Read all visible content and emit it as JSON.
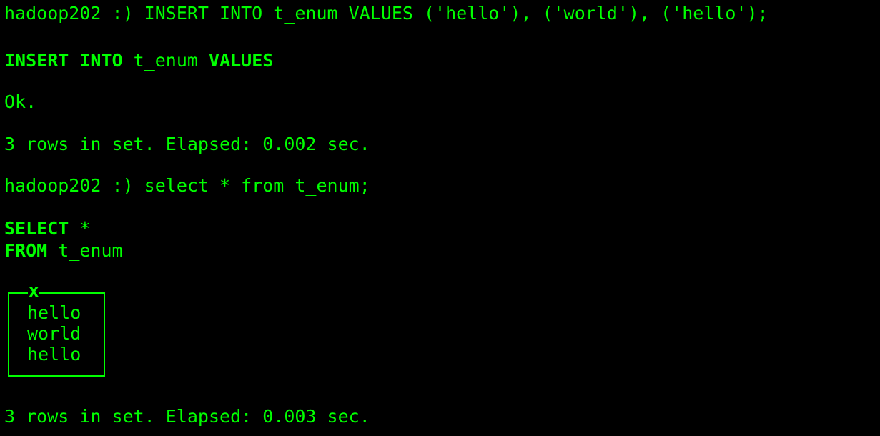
{
  "terminal": {
    "prompt1": "hadoop202 :) INSERT INTO t_enum VALUES ('hello'), ('world'), ('hello');",
    "echo1": {
      "kw_insert": "INSERT",
      "kw_into": "INTO",
      "table": "t_enum",
      "kw_values": "VALUES"
    },
    "ok": "Ok.",
    "status1": "3 rows in set. Elapsed: 0.002 sec.",
    "prompt2": "hadoop202 :) select * from t_enum;",
    "echo2": {
      "kw_select": "SELECT",
      "star": "*",
      "kw_from": "FROM",
      "table": "t_enum"
    },
    "result": {
      "column": "x",
      "rows": [
        "hello",
        "world",
        "hello"
      ]
    },
    "status2": "3 rows in set. Elapsed: 0.003 sec."
  },
  "colors": {
    "background": "#000000",
    "text": "#00ff00"
  }
}
